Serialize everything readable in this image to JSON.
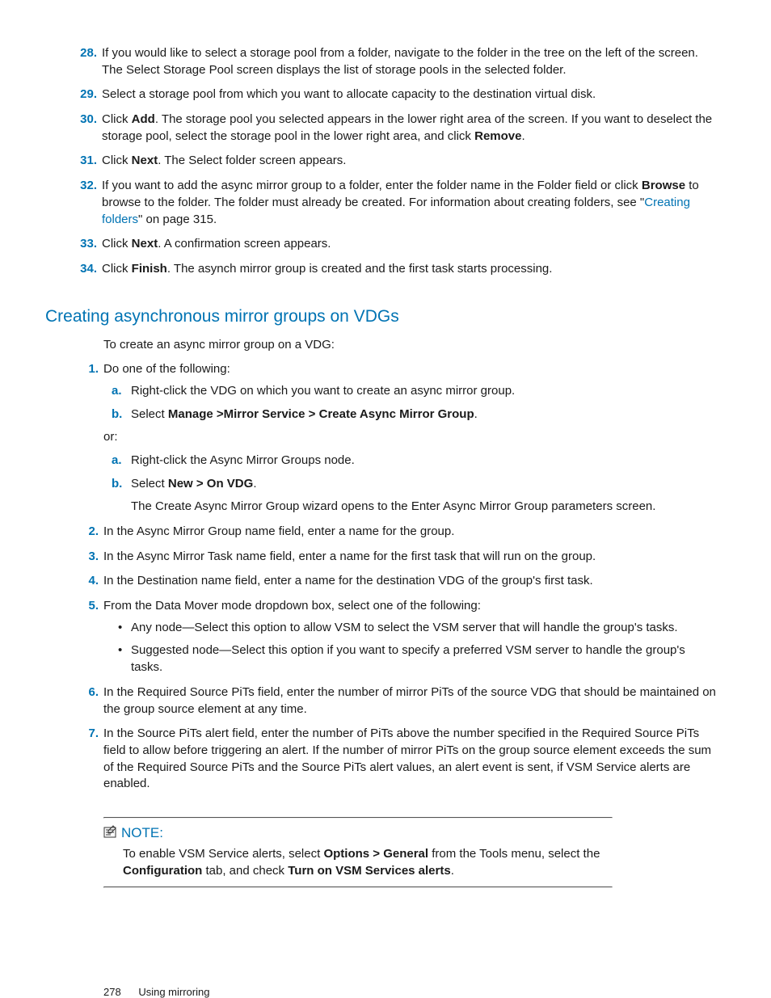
{
  "top_list": [
    {
      "n": "28.",
      "text": "If you would like to select a storage pool from a folder, navigate to the folder in the tree on the left of the screen. The Select Storage Pool screen displays the list of storage pools in the selected folder."
    },
    {
      "n": "29.",
      "text": "Select a storage pool from which you want to allocate capacity to the destination virtual disk."
    },
    {
      "n": "30.",
      "html": "Click <b>Add</b>. The storage pool you selected appears in the lower right area of the screen. If you want to deselect the storage pool, select the storage pool in the lower right area, and click <b>Remove</b>."
    },
    {
      "n": "31.",
      "html": "Click <b>Next</b>. The Select folder screen appears."
    },
    {
      "n": "32.",
      "html": "If you want to add the async mirror group to a folder, enter the folder name in the Folder field or click <b>Browse</b> to browse to the folder. The folder must already be created. For information about creating folders, see \"<a class='link' data-name='link-creating-folders' data-interactable='true'>Creating folders</a>\" on page 315."
    },
    {
      "n": "33.",
      "html": "Click <b>Next</b>. A confirmation screen appears."
    },
    {
      "n": "34.",
      "html": "Click <b>Finish</b>. The asynch mirror group is created and the first task starts processing."
    }
  ],
  "section_heading": "Creating asynchronous mirror groups on VDGs",
  "section_intro": "To create an async mirror group on a VDG:",
  "step1_lead": "Do one of the following:",
  "step1_groupA": [
    {
      "n": "a.",
      "text": "Right-click the VDG on which you want to create an async mirror group."
    },
    {
      "n": "b.",
      "html": "Select <b>Manage >Mirror Service > Create Async Mirror Group</b>."
    }
  ],
  "step1_or": "or:",
  "step1_groupB": [
    {
      "n": "a.",
      "text": "Right-click the Async Mirror Groups node."
    },
    {
      "n": "b.",
      "html": "Select <b>New > On VDG</b>."
    }
  ],
  "step1_groupB_cont": "The Create Async Mirror Group wizard opens to the Enter Async Mirror Group parameters screen.",
  "step2": "In the Async Mirror Group name field, enter a name for the group.",
  "step3": "In the Async Mirror Task name field, enter a name for the first task that will run on the group.",
  "step4": "In the Destination name field, enter a name for the destination VDG of the group's first task.",
  "step5_lead": "From the Data Mover mode dropdown box, select one of the following:",
  "step5_bullets": [
    "Any node—Select this option to allow VSM to select the VSM server that will handle the group's tasks.",
    "Suggested node—Select this option if you want to specify a preferred VSM server to handle the group's tasks."
  ],
  "step6": "In the Required Source PiTs field, enter the number of mirror PiTs of the source VDG that should be maintained on the group source element at any time.",
  "step7": "In the Source PiTs alert field, enter the number of PiTs above the number specified in the Required Source PiTs field to allow before triggering an alert. If the number of mirror PiTs on the group source element exceeds the sum of the Required Source PiTs and the Source PiTs alert values, an alert event is sent, if VSM Service alerts are enabled.",
  "note_label": "NOTE:",
  "note_body_html": "To enable VSM Service alerts, select <b>Options > General</b> from the Tools menu, select the <b>Configuration</b> tab, and check <b>Turn on VSM Services alerts</b>.",
  "footer": {
    "page": "278",
    "chapter": "Using mirroring"
  }
}
